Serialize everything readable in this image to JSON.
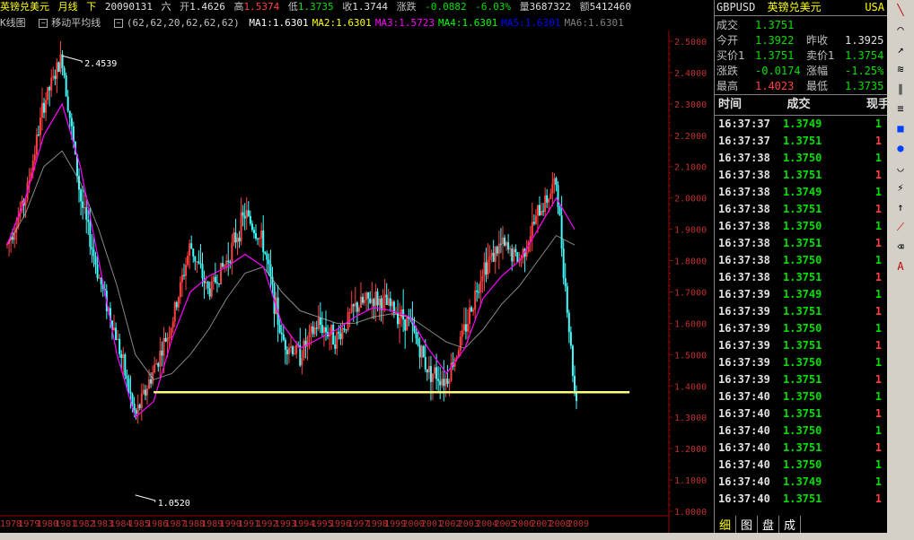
{
  "header": {
    "instrument": "英镑兑美元",
    "period": "月线",
    "direction": "下",
    "date": "20090131",
    "weekday": "六",
    "open_label": "开",
    "open": "1.4626",
    "high_label": "高",
    "high": "1.5374",
    "low_label": "低",
    "low": "1.3735",
    "close_label": "收",
    "close": "1.3744",
    "change_label": "涨跌",
    "change": "-0.0882",
    "change_pct": "-6.03%",
    "volume_label": "量",
    "volume": "3687322",
    "amount_label": "额",
    "amount": "5412460"
  },
  "indicator_bar": {
    "kline_label": "K线图",
    "ma_label": "移动平均线",
    "ma_params": "(62,62,20,62,62,62)",
    "ma_values": [
      {
        "label": "MA1:1.6301",
        "color": "#ffffff"
      },
      {
        "label": "MA2:1.6301",
        "color": "#ffff00"
      },
      {
        "label": "MA3:1.5723",
        "color": "#ff00ff"
      },
      {
        "label": "MA4:1.6301",
        "color": "#00ff00"
      },
      {
        "label": "MA5:1.6301",
        "color": "#0000ff"
      },
      {
        "label": "MA6:1.6301",
        "color": "#808080"
      }
    ]
  },
  "chart_data": {
    "type": "candlestick",
    "ylim": [
      1.0,
      2.5
    ],
    "y_ticks": [
      "2.5000",
      "2.4000",
      "2.3000",
      "2.2000",
      "2.1000",
      "2.0000",
      "1.9000",
      "1.8000",
      "1.7000",
      "1.6000",
      "1.5000",
      "1.4000",
      "1.3000",
      "1.2000",
      "1.1000",
      "1.0000"
    ],
    "x_ticks": [
      "1978",
      "1979",
      "1980",
      "1981",
      "1982",
      "1983",
      "1984",
      "1985",
      "1986",
      "1987",
      "1988",
      "1989",
      "1990",
      "1991",
      "1992",
      "1993",
      "1994",
      "1995",
      "1996",
      "1997",
      "1998",
      "1999",
      "2000",
      "2001",
      "2002",
      "2003",
      "2004",
      "2005",
      "2006",
      "2007",
      "2008",
      "2009"
    ],
    "annotations": [
      {
        "text": "2.4539",
        "x": "1981",
        "y": 2.4539
      },
      {
        "text": "1.0520",
        "x": "1985",
        "y": 1.052
      }
    ],
    "support_line": {
      "y": 1.38,
      "from": "1986",
      "to": "2012",
      "color": "#ffff80"
    },
    "price_path": [
      [
        "1978",
        1.85
      ],
      [
        "1979",
        2.0
      ],
      [
        "1980",
        2.3
      ],
      [
        "1981",
        2.45
      ],
      [
        "1982",
        2.0
      ],
      [
        "1983",
        1.75
      ],
      [
        "1984",
        1.55
      ],
      [
        "1985",
        1.3
      ],
      [
        "1986",
        1.45
      ],
      [
        "1987",
        1.6
      ],
      [
        "1988",
        1.85
      ],
      [
        "1989",
        1.7
      ],
      [
        "1990",
        1.8
      ],
      [
        "1991",
        1.95
      ],
      [
        "1992",
        1.85
      ],
      [
        "1993",
        1.55
      ],
      [
        "1994",
        1.5
      ],
      [
        "1995",
        1.6
      ],
      [
        "1996",
        1.55
      ],
      [
        "1997",
        1.65
      ],
      [
        "1998",
        1.68
      ],
      [
        "1999",
        1.65
      ],
      [
        "2000",
        1.6
      ],
      [
        "2001",
        1.45
      ],
      [
        "2002",
        1.42
      ],
      [
        "2003",
        1.58
      ],
      [
        "2004",
        1.78
      ],
      [
        "2005",
        1.85
      ],
      [
        "2006",
        1.8
      ],
      [
        "2007",
        1.95
      ],
      [
        "2008",
        2.05
      ],
      [
        "2009",
        1.38
      ]
    ],
    "ma_fast": [
      [
        "1978",
        1.85
      ],
      [
        "1979",
        2.0
      ],
      [
        "1980",
        2.2
      ],
      [
        "1981",
        2.3
      ],
      [
        "1982",
        2.1
      ],
      [
        "1983",
        1.8
      ],
      [
        "1984",
        1.5
      ],
      [
        "1985",
        1.3
      ],
      [
        "1986",
        1.35
      ],
      [
        "1987",
        1.55
      ],
      [
        "1988",
        1.7
      ],
      [
        "1989",
        1.75
      ],
      [
        "1990",
        1.78
      ],
      [
        "1991",
        1.82
      ],
      [
        "1992",
        1.78
      ],
      [
        "1993",
        1.6
      ],
      [
        "1994",
        1.52
      ],
      [
        "1995",
        1.55
      ],
      [
        "1996",
        1.58
      ],
      [
        "1997",
        1.62
      ],
      [
        "1998",
        1.65
      ],
      [
        "1999",
        1.64
      ],
      [
        "2000",
        1.62
      ],
      [
        "2001",
        1.52
      ],
      [
        "2002",
        1.44
      ],
      [
        "2003",
        1.52
      ],
      [
        "2004",
        1.68
      ],
      [
        "2005",
        1.75
      ],
      [
        "2006",
        1.8
      ],
      [
        "2007",
        1.9
      ],
      [
        "2008",
        2.0
      ],
      [
        "2009",
        1.9
      ]
    ],
    "ma_slow": [
      [
        "1978",
        1.85
      ],
      [
        "1979",
        1.95
      ],
      [
        "1980",
        2.1
      ],
      [
        "1981",
        2.15
      ],
      [
        "1982",
        2.05
      ],
      [
        "1983",
        1.9
      ],
      [
        "1984",
        1.72
      ],
      [
        "1985",
        1.5
      ],
      [
        "1986",
        1.42
      ],
      [
        "1987",
        1.44
      ],
      [
        "1988",
        1.5
      ],
      [
        "1989",
        1.58
      ],
      [
        "1990",
        1.68
      ],
      [
        "1991",
        1.76
      ],
      [
        "1992",
        1.78
      ],
      [
        "1993",
        1.7
      ],
      [
        "1994",
        1.64
      ],
      [
        "1995",
        1.62
      ],
      [
        "1996",
        1.6
      ],
      [
        "1997",
        1.6
      ],
      [
        "1998",
        1.62
      ],
      [
        "1999",
        1.63
      ],
      [
        "2000",
        1.62
      ],
      [
        "2001",
        1.58
      ],
      [
        "2002",
        1.54
      ],
      [
        "2003",
        1.52
      ],
      [
        "2004",
        1.58
      ],
      [
        "2005",
        1.66
      ],
      [
        "2006",
        1.72
      ],
      [
        "2007",
        1.8
      ],
      [
        "2008",
        1.88
      ],
      [
        "2009",
        1.85
      ]
    ]
  },
  "quote": {
    "code": "GBPUSD",
    "name": "英镑兑美元",
    "market": "USA",
    "rows": [
      [
        {
          "l": "成交",
          "v": "1.3751",
          "c": "#00e000"
        }
      ],
      [
        {
          "l": "今开",
          "v": "1.3922",
          "c": "#00e000"
        },
        {
          "l": "昨收",
          "v": "1.3925",
          "c": "#e0e0e0"
        }
      ],
      [
        {
          "l": "买价1",
          "v": "1.3751",
          "c": "#00e000"
        },
        {
          "l": "卖价1",
          "v": "1.3754",
          "c": "#00e000"
        }
      ],
      [
        {
          "l": "涨跌",
          "v": "-0.0174",
          "c": "#00e000"
        },
        {
          "l": "涨幅",
          "v": "-1.25%",
          "c": "#00e000"
        }
      ],
      [
        {
          "l": "最高",
          "v": "1.4023",
          "c": "#ff4040"
        },
        {
          "l": "最低",
          "v": "1.3735",
          "c": "#00e000"
        }
      ]
    ]
  },
  "ticks": {
    "headers": {
      "time": "时间",
      "price": "成交",
      "vol": "现手"
    },
    "rows": [
      {
        "t": "16:37:37",
        "p": "1.3749",
        "v": "1",
        "c": "#00e000"
      },
      {
        "t": "16:37:37",
        "p": "1.3751",
        "v": "1",
        "c": "#ff4040"
      },
      {
        "t": "16:37:38",
        "p": "1.3750",
        "v": "1",
        "c": "#00e000"
      },
      {
        "t": "16:37:38",
        "p": "1.3751",
        "v": "1",
        "c": "#ff4040"
      },
      {
        "t": "16:37:38",
        "p": "1.3749",
        "v": "1",
        "c": "#00e000"
      },
      {
        "t": "16:37:38",
        "p": "1.3751",
        "v": "1",
        "c": "#ff4040"
      },
      {
        "t": "16:37:38",
        "p": "1.3750",
        "v": "1",
        "c": "#00e000"
      },
      {
        "t": "16:37:38",
        "p": "1.3751",
        "v": "1",
        "c": "#ff4040"
      },
      {
        "t": "16:37:38",
        "p": "1.3750",
        "v": "1",
        "c": "#00e000"
      },
      {
        "t": "16:37:38",
        "p": "1.3751",
        "v": "1",
        "c": "#ff4040"
      },
      {
        "t": "16:37:39",
        "p": "1.3749",
        "v": "1",
        "c": "#00e000"
      },
      {
        "t": "16:37:39",
        "p": "1.3751",
        "v": "1",
        "c": "#ff4040"
      },
      {
        "t": "16:37:39",
        "p": "1.3750",
        "v": "1",
        "c": "#00e000"
      },
      {
        "t": "16:37:39",
        "p": "1.3751",
        "v": "1",
        "c": "#ff4040"
      },
      {
        "t": "16:37:39",
        "p": "1.3750",
        "v": "1",
        "c": "#00e000"
      },
      {
        "t": "16:37:39",
        "p": "1.3751",
        "v": "1",
        "c": "#ff4040"
      },
      {
        "t": "16:37:40",
        "p": "1.3750",
        "v": "1",
        "c": "#00e000"
      },
      {
        "t": "16:37:40",
        "p": "1.3751",
        "v": "1",
        "c": "#ff4040"
      },
      {
        "t": "16:37:40",
        "p": "1.3750",
        "v": "1",
        "c": "#00e000"
      },
      {
        "t": "16:37:40",
        "p": "1.3751",
        "v": "1",
        "c": "#ff4040"
      },
      {
        "t": "16:37:40",
        "p": "1.3750",
        "v": "1",
        "c": "#00e000"
      },
      {
        "t": "16:37:40",
        "p": "1.3749",
        "v": "1",
        "c": "#00e000"
      },
      {
        "t": "16:37:40",
        "p": "1.3751",
        "v": "1",
        "c": "#ff4040"
      }
    ]
  },
  "tabs": [
    "细",
    "图",
    "盘",
    "成"
  ],
  "tools": [
    "line-tool-icon",
    "arc-tool-icon",
    "ray-tool-icon",
    "channel-tool-icon",
    "parallel-tool-icon",
    "fib-tool-icon",
    "rect-tool-icon",
    "ellipse-tool-icon",
    "cycle-tool-icon",
    "gann-tool-icon",
    "arrow-up-tool-icon",
    "speed-tool-icon",
    "erase-tool-icon",
    "text-tool-icon"
  ],
  "colors": {
    "up": "#ff4040",
    "down": "#40ffff",
    "axis": "#a00000",
    "ma_fast": "#ff00ff",
    "ma_slow": "#c0c0c0"
  }
}
